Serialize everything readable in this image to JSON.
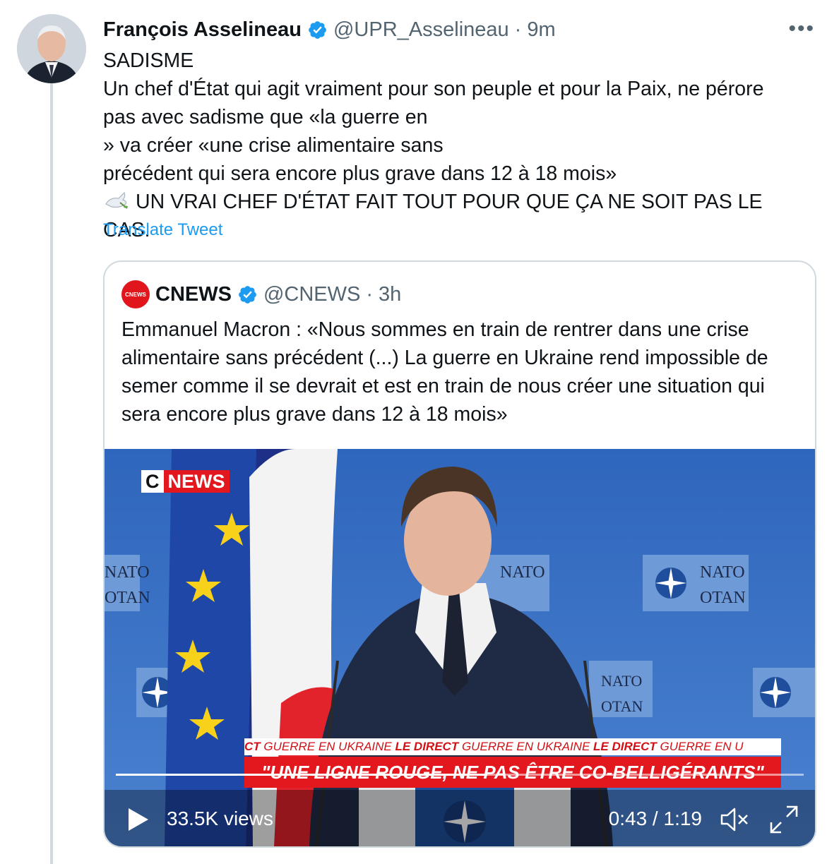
{
  "tweet": {
    "author_name": "François Asselineau",
    "handle": "@UPR_Asselineau",
    "separator": "·",
    "time": "9m",
    "more_label": "•••",
    "lines": {
      "l1": "SADISME",
      "l2": "Un chef d'État qui agit vraiment pour son peuple et pour la Paix, ne pérore",
      "l3a": "pas avec sadisme que «la guerre en",
      "l3b": "» va créer «une crise alimentaire sans",
      "l4": "précédent qui sera encore plus grave dans 12 à 18 mois»",
      "l5": "UN VRAI CHEF D'ÉTAT FAIT TOUT POUR QUE ÇA NE SOIT PAS LE",
      "l6": "CAS."
    },
    "translate_label": "Translate Tweet"
  },
  "quote": {
    "avatar_text": "CNEWS",
    "author_name": "CNEWS",
    "handle": "@CNEWS",
    "separator": "·",
    "time": "3h",
    "text": "Emmanuel Macron : «Nous sommes en train de rentrer dans une crise alimentaire sans précédent (...) La guerre en Ukraine rend impossible de semer comme il se devrait et est en train de nous créer une situation qui sera encore plus grave dans 12 à 18 mois»"
  },
  "video": {
    "logo_c": "C",
    "logo_news": "NEWS",
    "ticker": {
      "t1": "CT  ",
      "t2": "GUERRE EN UKRAINE  ",
      "t3": "LE DIRECT  ",
      "t4": "GUERRE EN UKRAINE  ",
      "t5": "LE DIRECT  ",
      "t6": "GUERRE EN U"
    },
    "banner": "\"UNE LIGNE ROUGE, NE PAS ÊTRE CO-BELLIGÉRANTS\"",
    "backdrop_signs": {
      "nato": "NATO",
      "otan": "OTAN"
    },
    "views": "33.5K views",
    "time_display": "0:43 / 1:19",
    "progress": 0.54
  },
  "colors": {
    "link": "#1d9bf0",
    "verified": "#1d9bf0",
    "muted": "#536471",
    "cnews_red": "#e2181e",
    "backdrop_blue": "#3f74c4"
  },
  "icons": [
    "verified-badge-icon",
    "more-icon",
    "dove-emoji-icon",
    "ukraine-flag-emoji-icon",
    "play-icon",
    "mute-icon",
    "fullscreen-icon"
  ]
}
